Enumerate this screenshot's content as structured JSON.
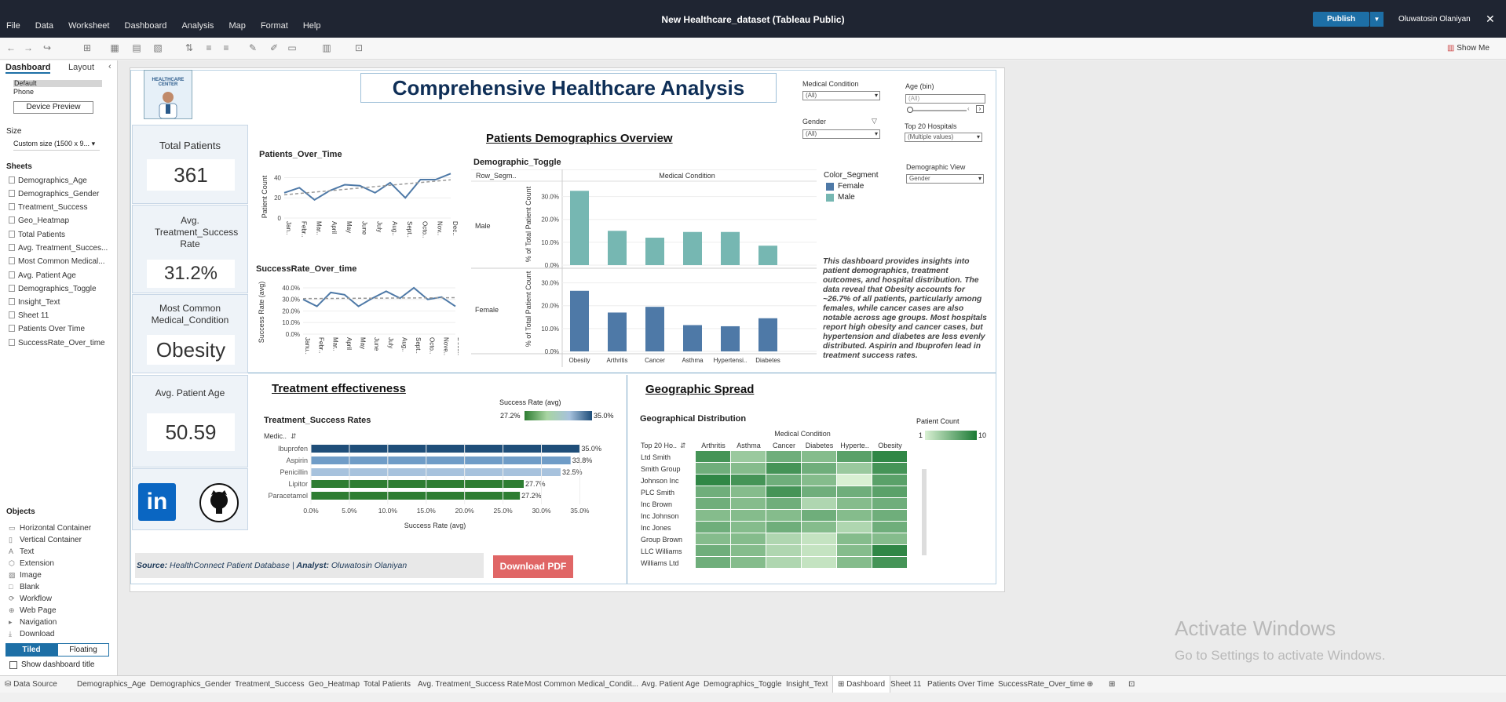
{
  "app": {
    "title": "New Healthcare_dataset (Tableau Public)",
    "menu": [
      "File",
      "Data",
      "Worksheet",
      "Dashboard",
      "Analysis",
      "Map",
      "Format",
      "Help"
    ],
    "publish_label": "Publish",
    "user": "Oluwatosin Olaniyan",
    "show_me": "Show Me",
    "accent": "#1d6fa6"
  },
  "left_panel": {
    "tabs": [
      "Dashboard",
      "Layout"
    ],
    "device_default": "Default",
    "device_phone": "Phone",
    "device_preview": "Device Preview",
    "size_label": "Size",
    "size_value": "Custom size (1500 x 9...",
    "sheets_label": "Sheets",
    "sheets": [
      "Demographics_Age",
      "Demographics_Gender",
      "Treatment_Success",
      "Geo_Heatmap",
      "Total Patients",
      "Avg. Treatment_Succes...",
      "Most Common Medical...",
      "Avg. Patient Age",
      "Demographics_Toggle",
      "Insight_Text",
      "Sheet 11",
      "Patients Over Time",
      "SuccessRate_Over_time"
    ],
    "objects_label": "Objects",
    "objects": [
      "Horizontal Container",
      "Vertical Container",
      "Text",
      "Extension",
      "Image",
      "Blank",
      "Workflow",
      "Web Page",
      "Navigation",
      "Download"
    ],
    "tiled": "Tiled",
    "floating": "Floating",
    "show_title": "Show dashboard title"
  },
  "dashboard": {
    "title": "Comprehensive Healthcare Analysis",
    "logo_text": "HEALTHCARE CENTER",
    "kpis": {
      "total_patients_label": "Total Patients",
      "total_patients": "361",
      "avg_success_label": "Avg. Treatment_Success Rate",
      "avg_success": "31.2%",
      "common_condition_label": "Most Common Medical_Condition",
      "common_condition": "Obesity",
      "avg_age_label": "Avg. Patient Age",
      "avg_age": "50.59"
    },
    "filters": {
      "medical_condition_label": "Medical Condition",
      "medical_condition_value": "(All)",
      "age_label": "Age (bin)",
      "age_value": "(All)",
      "gender_label": "Gender",
      "gender_value": "(All)",
      "top_hospitals_label": "Top 20 Hospitals",
      "top_hospitals_value": "(Multiple values)",
      "demographic_view_label": "Demographic View",
      "demographic_view_value": "Gender"
    },
    "demographics_title": "Patients Demographics Overview",
    "demographic_toggle_title": "Demographic_Toggle",
    "row_segment_header": "Row_Segm..",
    "medical_condition_header": "Medical Condition",
    "y_axis_label": "% of Total Patient Count",
    "legend_title": "Color_Segment",
    "legend": [
      "Female",
      "Male"
    ],
    "row_labels": [
      "Male",
      "Female"
    ],
    "insight_text": "This dashboard provides insights into patient demographics, treatment outcomes, and hospital distribution. The data reveal that Obesity accounts for ~26.7% of all patients, particularly among females, while cancer cases are also notable across age groups. Most hospitals report high obesity and cancer cases, but hypertension and diabetes are less evenly distributed. Aspirin and Ibuprofen lead in treatment success rates.",
    "patients_over_time_title": "Patients_Over_Time",
    "patients_axis": "Patient Count",
    "success_over_time_title": "SuccessRate_Over_time",
    "success_axis": "Success Rate (avg)",
    "treatment_title": "Treatment effectiveness",
    "treatment_chart_title": "Treatment_Success Rates",
    "treatment_dim": "Medic..",
    "treatment_legend_title": "Success Rate (avg)",
    "treatment_legend_min": "27.2%",
    "treatment_legend_max": "35.0%",
    "treatment_x_label": "Success Rate (avg)",
    "geo_title": "Geographic Spread",
    "geo_chart_title": "Geographical Distribution",
    "geo_col_header": "Medical Condition",
    "geo_row_header": "Top 20 Ho..",
    "geo_legend_title": "Patient Count",
    "geo_legend_min": "1",
    "geo_legend_max": "10",
    "source_label": "Source:",
    "source_value": "HealthConnect Patient Database",
    "analyst_label": "Analyst:",
    "analyst_value": "Oluwatosin Olaniyan",
    "download_label": "Download PDF",
    "male_color": "#76b7b2",
    "female_color": "#4e79a7"
  },
  "chart_data": [
    {
      "type": "bar",
      "title": "Demographic_Toggle",
      "categories": [
        "Obesity",
        "Arthritis",
        "Cancer",
        "Asthma",
        "Hypertensi..",
        "Diabetes"
      ],
      "ylabel": "% of Total Patient Count",
      "ylim": [
        0,
        35
      ],
      "yticks": [
        "0.0%",
        "10.0%",
        "20.0%",
        "30.0%"
      ],
      "series": [
        {
          "name": "Male",
          "values": [
            32.5,
            15.0,
            12.0,
            14.5,
            14.5,
            8.5
          ]
        },
        {
          "name": "Female",
          "values": [
            26.5,
            17.0,
            19.5,
            11.5,
            11.0,
            14.5
          ]
        }
      ]
    },
    {
      "type": "line",
      "title": "Patients_Over_Time",
      "ylabel": "Patient Count",
      "x": [
        "Jan..",
        "Febr..",
        "Mar..",
        "April",
        "May",
        "June",
        "July",
        "Aug..",
        "Sept..",
        "Octo..",
        "Nov..",
        "Dec.."
      ],
      "values": [
        25,
        30,
        18,
        27,
        33,
        32,
        25,
        35,
        20,
        38,
        38,
        44
      ],
      "ylim": [
        0,
        45
      ],
      "yticks": [
        "0",
        "20",
        "40"
      ]
    },
    {
      "type": "line",
      "title": "SuccessRate_Over_time",
      "ylabel": "Success Rate (avg)",
      "x": [
        "Janu..",
        "Febr..",
        "Mar..",
        "April",
        "May",
        "June",
        "July",
        "Aug..",
        "Sept..",
        "Octo..",
        "Nove..",
        "Dece.."
      ],
      "values": [
        30,
        24,
        36,
        34,
        24,
        31,
        37,
        31,
        40,
        30,
        32,
        24
      ],
      "ylim": [
        0,
        42
      ],
      "yticks": [
        "0.0%",
        "10.0%",
        "20.0%",
        "30.0%",
        "40.0%"
      ]
    },
    {
      "type": "bar",
      "title": "Treatment_Success Rates",
      "categories": [
        "Ibuprofen",
        "Aspirin",
        "Penicillin",
        "Lipitor",
        "Paracetamol"
      ],
      "values": [
        35.0,
        33.8,
        32.5,
        27.7,
        27.2
      ],
      "labels": [
        "35.0%",
        "33.8%",
        "32.5%",
        "27.7%",
        "27.2%"
      ],
      "xlabel": "Success Rate (avg)",
      "xlim": [
        0,
        37
      ],
      "xticks": [
        "0.0%",
        "5.0%",
        "10.0%",
        "15.0%",
        "20.0%",
        "25.0%",
        "30.0%",
        "35.0%"
      ]
    },
    {
      "type": "heatmap",
      "title": "Geographical Distribution",
      "columns": [
        "Arthritis",
        "Asthma",
        "Cancer",
        "Diabetes",
        "Hyperte..",
        "Obesity"
      ],
      "rows": [
        "Ltd Smith",
        "Smith Group",
        "Johnson Inc",
        "PLC Smith",
        "Inc Brown",
        "Inc Johnson",
        "Inc Jones",
        "Group Brown",
        "LLC Williams",
        "Williams Ltd"
      ],
      "values": [
        [
          8,
          4,
          6,
          5,
          7,
          9
        ],
        [
          6,
          5,
          8,
          6,
          4,
          8
        ],
        [
          9,
          8,
          6,
          5,
          1,
          7
        ],
        [
          6,
          5,
          8,
          6,
          6,
          7
        ],
        [
          6,
          5,
          6,
          3,
          5,
          6
        ],
        [
          5,
          5,
          5,
          6,
          5,
          6
        ],
        [
          6,
          5,
          6,
          5,
          3,
          6
        ],
        [
          5,
          5,
          3,
          2,
          5,
          5
        ],
        [
          6,
          5,
          3,
          2,
          5,
          9
        ],
        [
          6,
          5,
          3,
          2,
          5,
          8
        ]
      ],
      "range": [
        1,
        10
      ]
    }
  ],
  "bottom_tabs": [
    "Data Source",
    "Demographics_Age",
    "Demographics_Gender",
    "Treatment_Success",
    "Geo_Heatmap",
    "Total Patients",
    "Avg. Treatment_Success Rate",
    "Most Common Medical_Condit...",
    "Avg. Patient Age",
    "Demographics_Toggle",
    "Insight_Text",
    "Dashboard",
    "Sheet 11",
    "Patients Over Time",
    "SuccessRate_Over_time"
  ],
  "watermark": {
    "line1": "Activate Windows",
    "line2": "Go to Settings to activate Windows."
  }
}
